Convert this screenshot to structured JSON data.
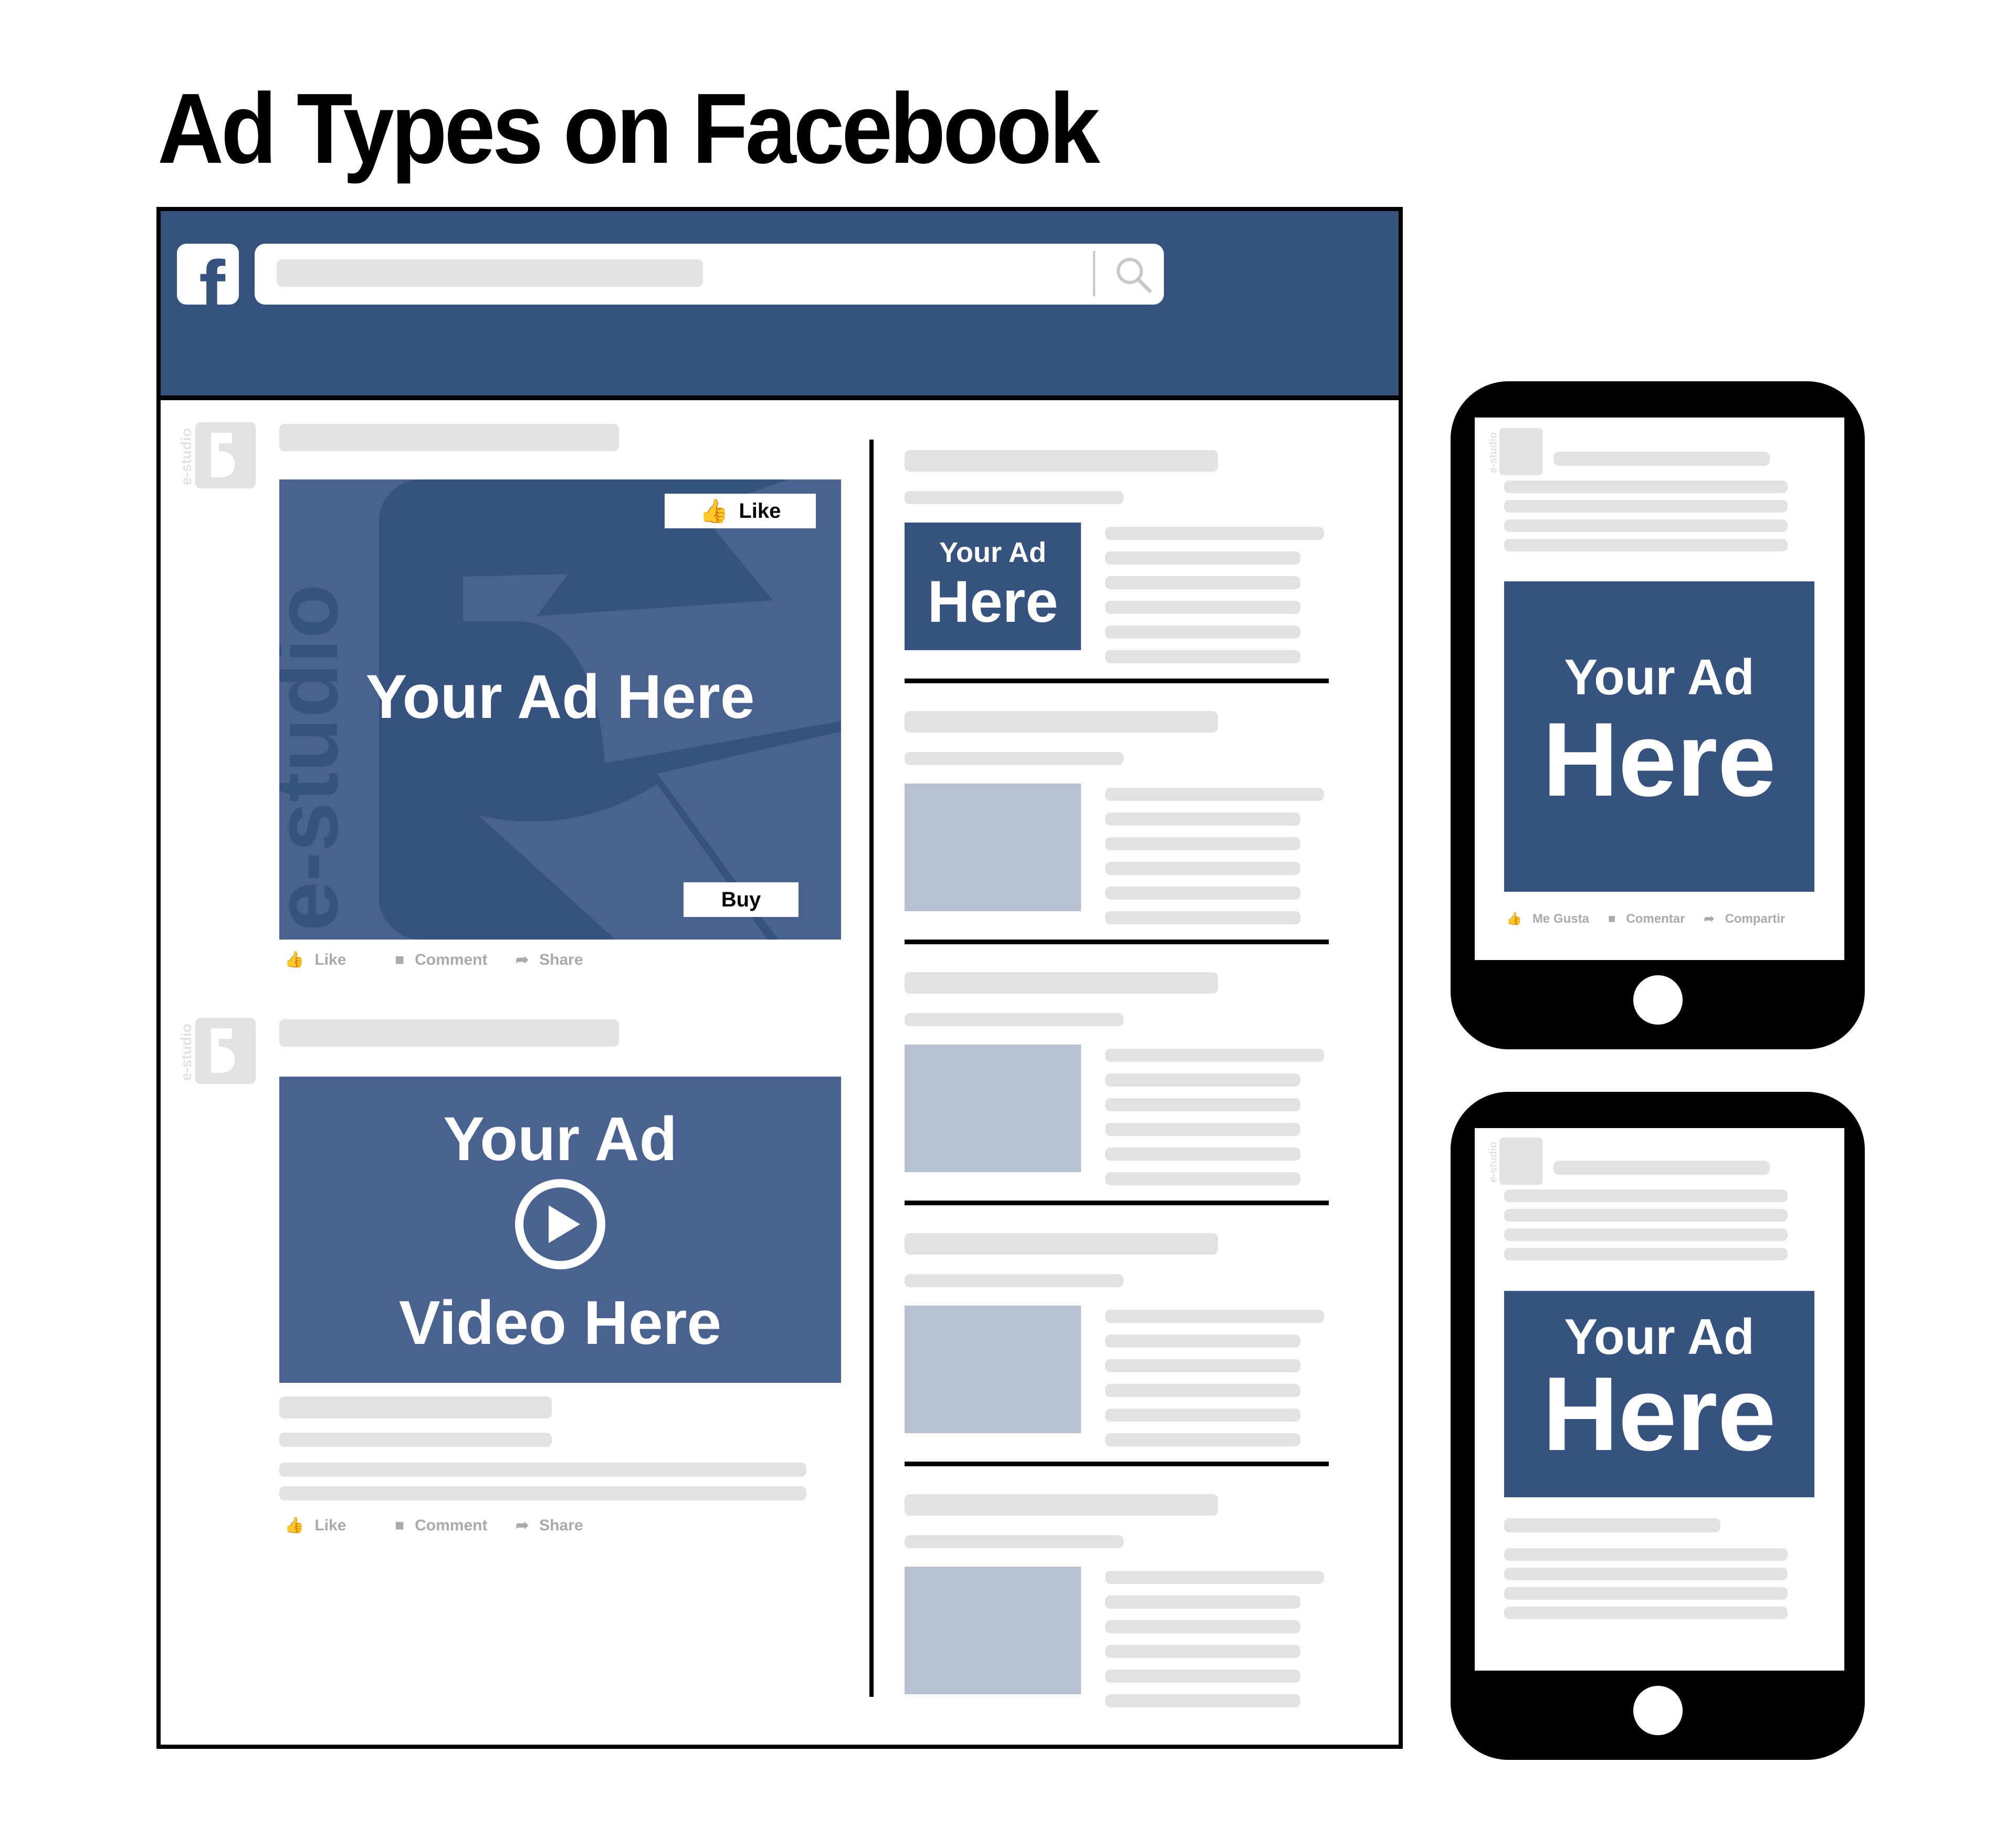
{
  "title": "Ad Types on Facebook",
  "colors": {
    "header_blue": "#36527f",
    "ad_blue": "#4a6290",
    "placeholder_gray": "#e2e2e2",
    "thumbnail_gray_blue": "#b7c1d1",
    "action_gray": "#aaaaaa"
  },
  "header": {
    "logo_icon": "facebook-f-icon",
    "search_icon": "magnifier-icon"
  },
  "feed": {
    "post1": {
      "ad_text": "Your Ad Here",
      "like_button": "Like",
      "buy_button": "Buy",
      "watermark": "e-studio",
      "actions": {
        "like": "Like",
        "comment": "Comment",
        "share": "Share"
      }
    },
    "post2": {
      "ad_line1": "Your Ad",
      "ad_line2": "Video Here",
      "play_icon": "play-circle-icon",
      "actions": {
        "like": "Like",
        "comment": "Comment",
        "share": "Share"
      }
    }
  },
  "right_column": {
    "ad_line1": "Your Ad",
    "ad_line2": "Here",
    "placeholder_sections": 4
  },
  "phone1": {
    "ad_line1": "Your Ad",
    "ad_line2": "Here",
    "actions": {
      "like": "Me Gusta",
      "comment": "Comentar",
      "share": "Compartir"
    }
  },
  "phone2": {
    "ad_line1": "Your Ad",
    "ad_line2": "Here"
  },
  "avatar_watermark": "e-studio"
}
